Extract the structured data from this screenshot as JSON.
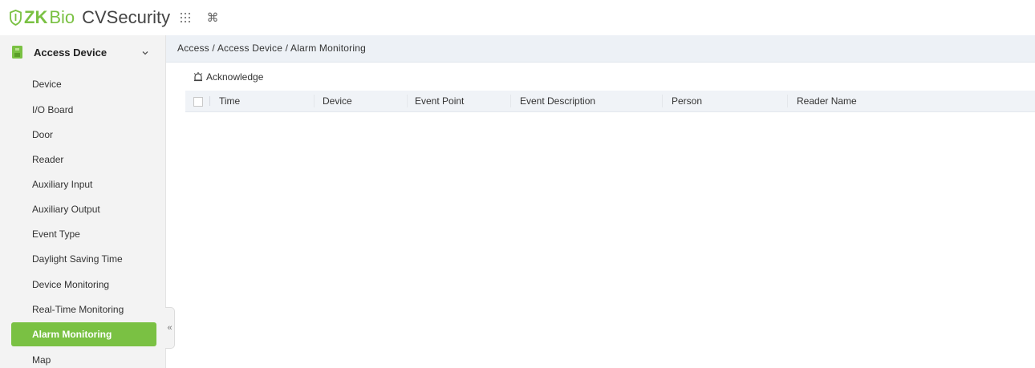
{
  "header": {
    "logo_zk": "ZK",
    "logo_bio": "Bio",
    "logo_product": "CVSecurity",
    "icons": [
      "apps-grid-icon",
      "command-icon"
    ]
  },
  "sidebar": {
    "module_title": "Access Device",
    "items": [
      {
        "label": "Device"
      },
      {
        "label": "I/O Board"
      },
      {
        "label": "Door"
      },
      {
        "label": "Reader"
      },
      {
        "label": "Auxiliary Input"
      },
      {
        "label": "Auxiliary Output"
      },
      {
        "label": "Event Type"
      },
      {
        "label": "Daylight Saving Time"
      },
      {
        "label": "Device Monitoring"
      },
      {
        "label": "Real-Time Monitoring"
      },
      {
        "label": "Alarm Monitoring",
        "active": true
      },
      {
        "label": "Map"
      }
    ],
    "collapse_glyph": "«"
  },
  "main": {
    "breadcrumb": "Access / Access Device / Alarm Monitoring",
    "toolbar": {
      "acknowledge_label": "Acknowledge"
    },
    "grid": {
      "columns": [
        "Time",
        "Device",
        "Event Point",
        "Event Description",
        "Person",
        "Reader Name"
      ],
      "rows": []
    }
  },
  "colors": {
    "brand_green": "#7ac143",
    "sidebar_bg": "#f3f3f3",
    "breadcrumb_bg": "#edf1f6",
    "grid_header_bg": "#f0f3f7"
  }
}
